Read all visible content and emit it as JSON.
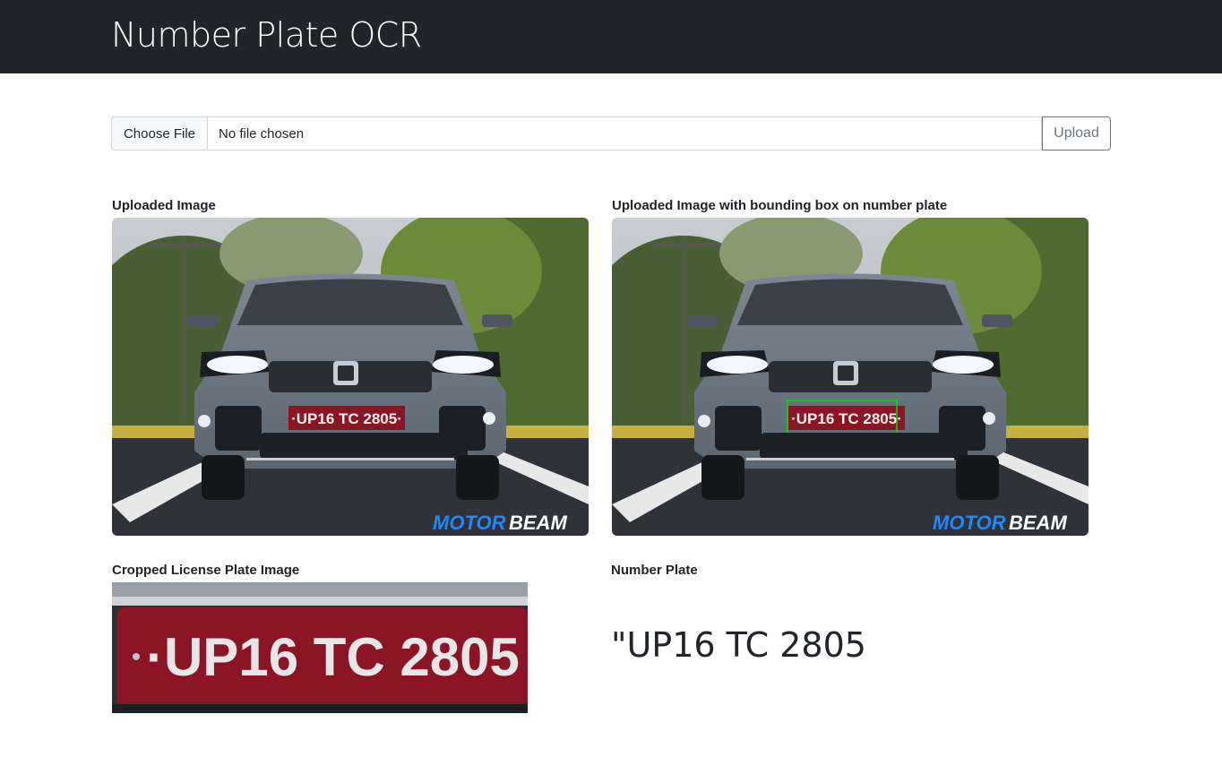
{
  "app": {
    "title": "Number Plate OCR"
  },
  "upload": {
    "choose_label": "Choose File",
    "file_status": "No file chosen",
    "submit_label": "Upload"
  },
  "sections": {
    "uploaded": "Uploaded Image",
    "bbox": "Uploaded Image with bounding box on number plate",
    "cropped": "Cropped License Plate Image",
    "number": "Number Plate"
  },
  "image": {
    "plate_text": "·UP16 TC 2805·",
    "watermark_a": "MOTOR",
    "watermark_b": "BEAM",
    "crop_text": "·UP16 TC 2805"
  },
  "result": {
    "plate": "\"UP16 TC 2805"
  },
  "colors": {
    "navbar": "#212529",
    "plate_red": "#8b1425",
    "bbox_green": "#00e000",
    "brand_blue": "#1e88ff"
  }
}
